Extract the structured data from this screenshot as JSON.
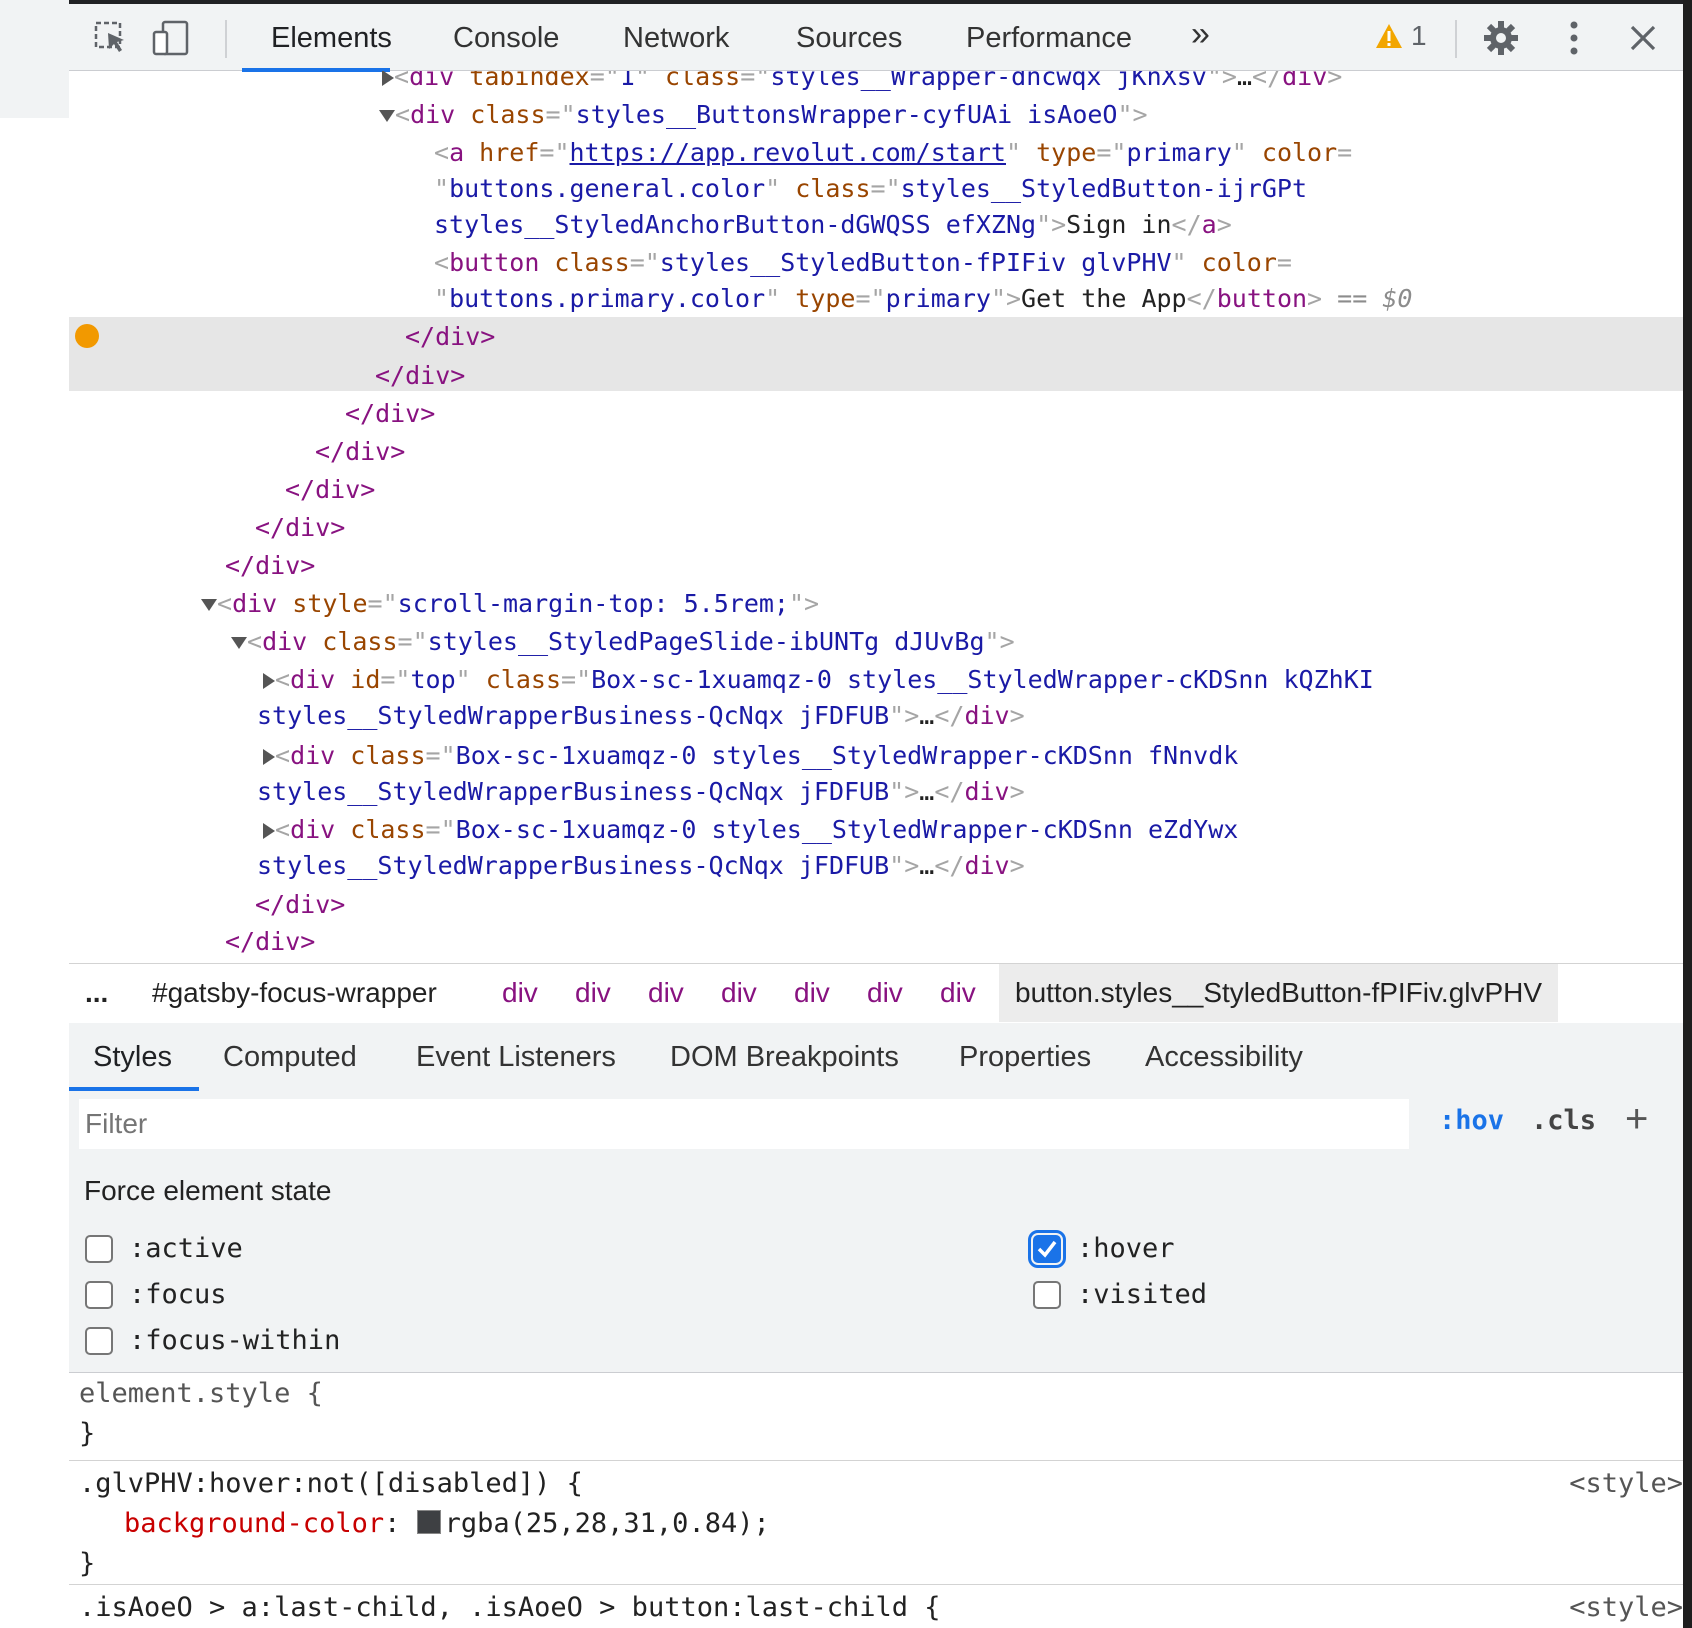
{
  "toolbar": {
    "tabs": [
      "Elements",
      "Console",
      "Network",
      "Sources",
      "Performance"
    ],
    "more_label": "»",
    "warning_count": "1"
  },
  "tree": {
    "line0": {
      "open": "<",
      "tag": "div",
      "a1": " tabindex",
      "eq1": "=\"",
      "v1": "1",
      "q1": "\" ",
      "a2": "class",
      "eq2": "=\"",
      "v2": "styles__Wrapper-dncwqx jKnXsv",
      "q2": "\">",
      "ell": "…",
      "close": "</",
      "ctag": "div",
      "end": ">"
    },
    "line1": {
      "open": "<",
      "tag": "div",
      "a1": " class",
      "eq1": "=\"",
      "v1": "styles__ButtonsWrapper-cyfUAi isAoeO",
      "end": "\">"
    },
    "line2": {
      "open": "<",
      "tag": "a",
      "a1": " href",
      "eq1": "=\"",
      "link": "https://app.revolut.com/start",
      "q1": "\" ",
      "a2": "type",
      "eq2": "=\"",
      "v2": "primary",
      "q2": "\" ",
      "a3": "color",
      "eq3": "="
    },
    "line3": {
      "q0": "\"",
      "v3": "buttons.general.color",
      "q3": "\" ",
      "a4": "class",
      "eq4": "=\"",
      "v4": "styles__StyledButton-ijrGPt"
    },
    "line4": {
      "v5": "styles__StyledAnchorButton-dGWQSS efXZNg",
      "q5": "\">",
      "text": "Sign in",
      "close": "</",
      "ctag": "a",
      "end": ">"
    },
    "line5": {
      "open": "<",
      "tag": "button",
      "a1": " class",
      "eq1": "=\"",
      "v1": "styles__StyledButton-fPIFiv glvPHV",
      "q1": "\" ",
      "a2": "color",
      "eq2": "="
    },
    "line6": {
      "q0": "\"",
      "v2": "buttons.primary.color",
      "q2": "\" ",
      "a3": "type",
      "eq3": "=\"",
      "v3": "primary",
      "q3": "\">",
      "text": "Get the App",
      "close": "</",
      "ctag": "button",
      "end": ">",
      "sel": " == $0"
    },
    "close_div": "</div>",
    "line13": {
      "open": "<",
      "tag": "div",
      "a1": " style",
      "eq1": "=\"",
      "v1": "scroll-margin-top: 5.5rem;",
      "end": "\">"
    },
    "line14": {
      "open": "<",
      "tag": "div",
      "a1": " class",
      "eq1": "=\"",
      "v1": "styles__StyledPageSlide-ibUNTg dJUvBg",
      "end": "\">"
    },
    "line15": {
      "open": "<",
      "tag": "div",
      "a1": " id",
      "eq1": "=\"",
      "v1": "top",
      "q1": "\" ",
      "a2": "class",
      "eq2": "=\"",
      "v2": "Box-sc-1xuamqz-0 styles__StyledWrapper-cKDSnn kQZhKI"
    },
    "line16": {
      "v": "styles__StyledWrapperBusiness-QcNqx jFDFUB",
      "q": "\">",
      "ell": "…",
      "close": "</",
      "ctag": "div",
      "end": ">"
    },
    "line17": {
      "open": "<",
      "tag": "div",
      "a1": " class",
      "eq1": "=\"",
      "v1": "Box-sc-1xuamqz-0 styles__StyledWrapper-cKDSnn fNnvdk"
    },
    "line18": {
      "v": "styles__StyledWrapperBusiness-QcNqx jFDFUB",
      "q": "\">",
      "ell": "…",
      "close": "</",
      "ctag": "div",
      "end": ">"
    },
    "line19": {
      "open": "<",
      "tag": "div",
      "a1": " class",
      "eq1": "=\"",
      "v1": "Box-sc-1xuamqz-0 styles__StyledWrapper-cKDSnn eZdYwx"
    },
    "line20": {
      "v": "styles__StyledWrapperBusiness-QcNqx jFDFUB",
      "q": "\">",
      "ell": "…",
      "close": "</",
      "ctag": "div",
      "end": ">"
    }
  },
  "breadcrumb": {
    "ellipsis": "...",
    "root": "#gatsby-focus-wrapper",
    "items": [
      "div",
      "div",
      "div",
      "div",
      "div",
      "div",
      "div"
    ],
    "selected": "button.styles__StyledButton-fPIFiv.glvPHV"
  },
  "styles_tabs": [
    "Styles",
    "Computed",
    "Event Listeners",
    "DOM Breakpoints",
    "Properties",
    "Accessibility"
  ],
  "filter": {
    "placeholder": "Filter",
    "hov": ":hov",
    "cls": ".cls",
    "plus": "+"
  },
  "force_state": {
    "title": "Force element state",
    "active": ":active",
    "focus": ":focus",
    "focus_within": ":focus-within",
    "hover": ":hover",
    "visited": ":visited",
    "hover_checked": true
  },
  "rules": {
    "r1_selector": "element.style {",
    "close": "}",
    "r2_selector": ".glvPHV:hover:not([disabled]) {",
    "r2_prop": "background-color",
    "r2_colon": ": ",
    "r2_value": "rgba(25,28,31,0.84);",
    "r2_swatch_color": "#3a3c3f",
    "r3_selector": ".isAoeO > a:last-child, .isAoeO > button:last-child {",
    "source": "<style>"
  },
  "colors": {
    "accent": "#1a73e8",
    "tag": "#881280",
    "attr": "#994500",
    "value": "#1a1aa6",
    "breakpoint": "#f29900"
  }
}
